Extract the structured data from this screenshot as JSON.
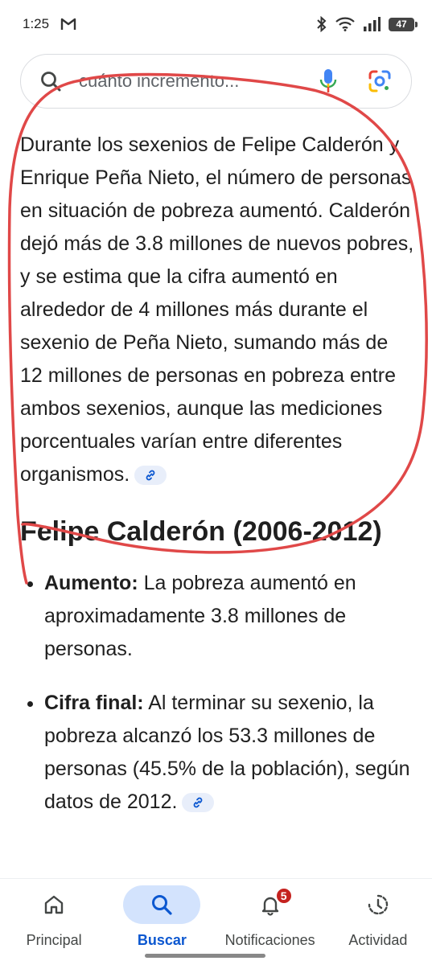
{
  "status_bar": {
    "time": "1:25",
    "battery": "47"
  },
  "search": {
    "query": "cuánto incremento..."
  },
  "content": {
    "intro": "Durante los sexenios de Felipe Calderón y Enrique Peña Nieto, el número de personas en situación de pobreza aumentó. Calderón dejó más de 3.8 millones de nuevos pobres, y se estima que la cifra aumentó en alrededor de 4 millones más durante el sexenio de Peña Nieto, sumando más de 12 millones de personas en pobreza entre ambos sexenios, aunque las mediciones porcentuales varían entre diferentes organismos.",
    "heading": "Felipe Calderón (2006-2012)",
    "bullets": [
      {
        "label": "Aumento:",
        "text": " La pobreza aumentó en aproximadamente 3.8 millones de personas."
      },
      {
        "label": "Cifra final:",
        "text": " Al terminar su sexenio, la pobreza alcanzó los 53.3 millones de personas (45.5% de la población), según datos de 2012."
      }
    ]
  },
  "bottom_nav": {
    "items": [
      {
        "label": "Principal",
        "icon": "home-icon"
      },
      {
        "label": "Buscar",
        "icon": "search-icon"
      },
      {
        "label": "Notificaciones",
        "icon": "bell-icon",
        "badge": "5"
      },
      {
        "label": "Actividad",
        "icon": "activity-icon"
      }
    ]
  },
  "colors": {
    "accent": "#0b57d0",
    "active_pill": "#d3e3fd",
    "annotation": "#e04848"
  }
}
